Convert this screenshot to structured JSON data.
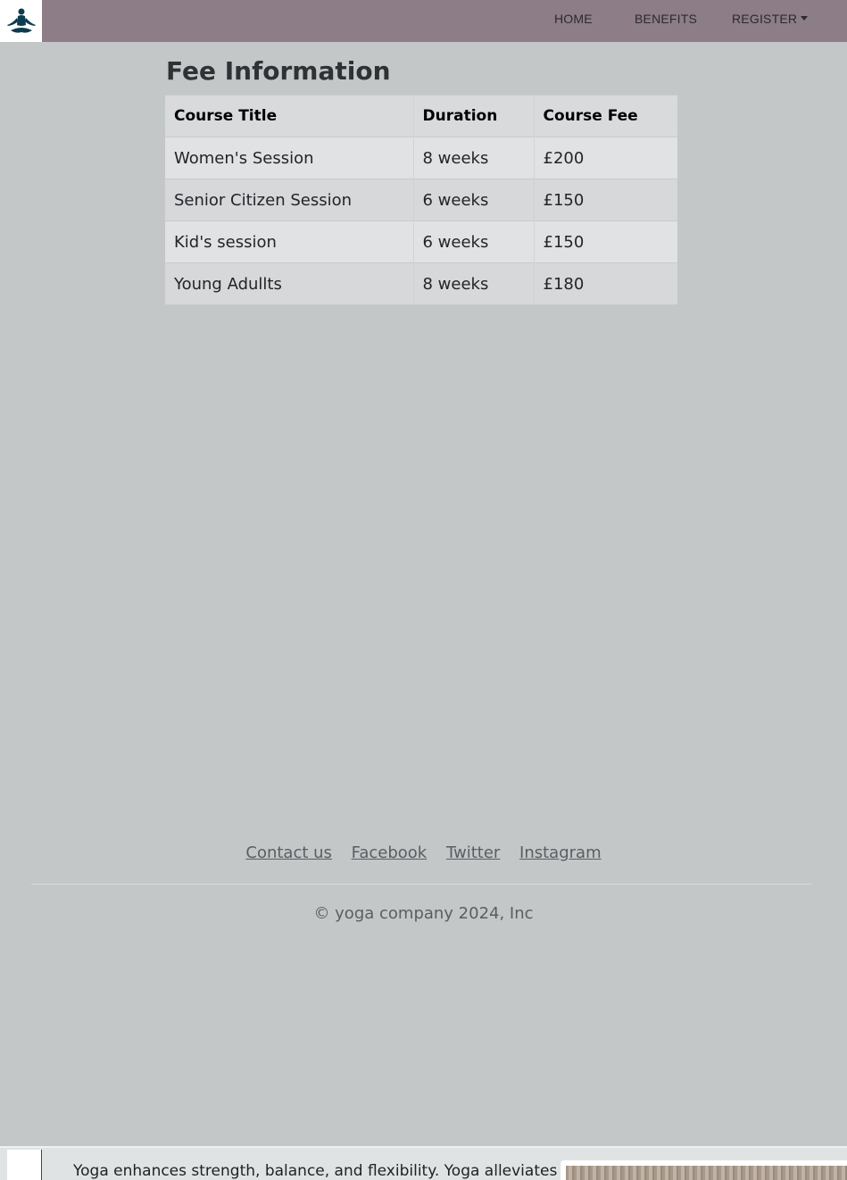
{
  "navbar": {
    "logo_icon": "meditation-figure-icon",
    "links": [
      "HOME",
      "BENEFITS"
    ],
    "register_label": "REGISTER"
  },
  "page_title": "Fee Information",
  "fee_table": {
    "headers": [
      "Course Title",
      "Duration",
      "Course Fee"
    ],
    "rows": [
      [
        "Women's Session",
        "8 weeks",
        "£200"
      ],
      [
        "Senior Citizen Session",
        "6 weeks",
        "£150"
      ],
      [
        "Kid's session",
        "6 weeks",
        "£150"
      ],
      [
        "Young Adullts",
        "8 weeks",
        "£180"
      ]
    ]
  },
  "footer": {
    "links": [
      "Contact us",
      "Facebook",
      "Twitter",
      "Instagram"
    ],
    "copyright": "© yoga company 2024, Inc"
  },
  "bottom_strip": {
    "text": "Yoga enhances strength, balance, and flexibility. Yoga alleviates"
  },
  "colors": {
    "navbar_bg": "#8c7d86",
    "page_bg": "#c3c7c8",
    "logo_fill": "#0d3b4f"
  }
}
